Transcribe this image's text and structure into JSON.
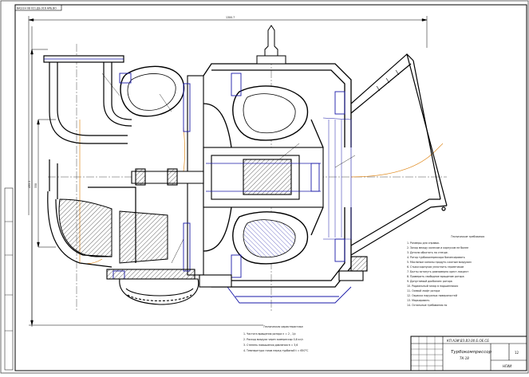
{
  "drawing": {
    "corner_stamp": "ВАЗ.ЕН 08 021.ДБ.016 АРБ.ВО",
    "dimensions": {
      "overall_length": "1300.7",
      "height_left": "493.5",
      "height_inner": "330"
    },
    "tech_notes_title": "Технические требования",
    "tech_notes": [
      "1. Размеры для справок.",
      "2. Зазор между колесом и корпусом не более",
      "3. Детали обкатать на стенде.",
      "4. Ротор турбокомпрессора балансировать",
      "5. Масляные каналы продуть сжатым воздухом",
      "6. Стыки корпусов уплотнить герметиком",
      "7. Болты затянуть равномерно крест-накрест",
      "8. Проверить свободное вращение ротора",
      "9. Допустимый дисбаланс ротора",
      "10. Радиальный зазор в подшипниках",
      "11. Осевой люфт ротора",
      "12. Окраска наружных поверхностей",
      "13. Маркировать",
      "14. Остальные требования по"
    ],
    "tech_char_title": "Техническая характеристика",
    "tech_char": [
      "1. Частота вращения ротора n = 2 , 1/с",
      "2. Расход воздуха через компрессор 0,6 кг/с",
      "3. Степень повышения давления π = 3,6",
      "4. Температура газов перед турбиной t = 650°С"
    ],
    "title_block": {
      "code": "КП.АЭИ.ВЗ.ВЗ.00 Б.ОЕ.СБ",
      "name_line1": "Турбокомпрессор",
      "name_line2": "ТК-18",
      "sheet": "12",
      "org": "НГИИ"
    }
  }
}
